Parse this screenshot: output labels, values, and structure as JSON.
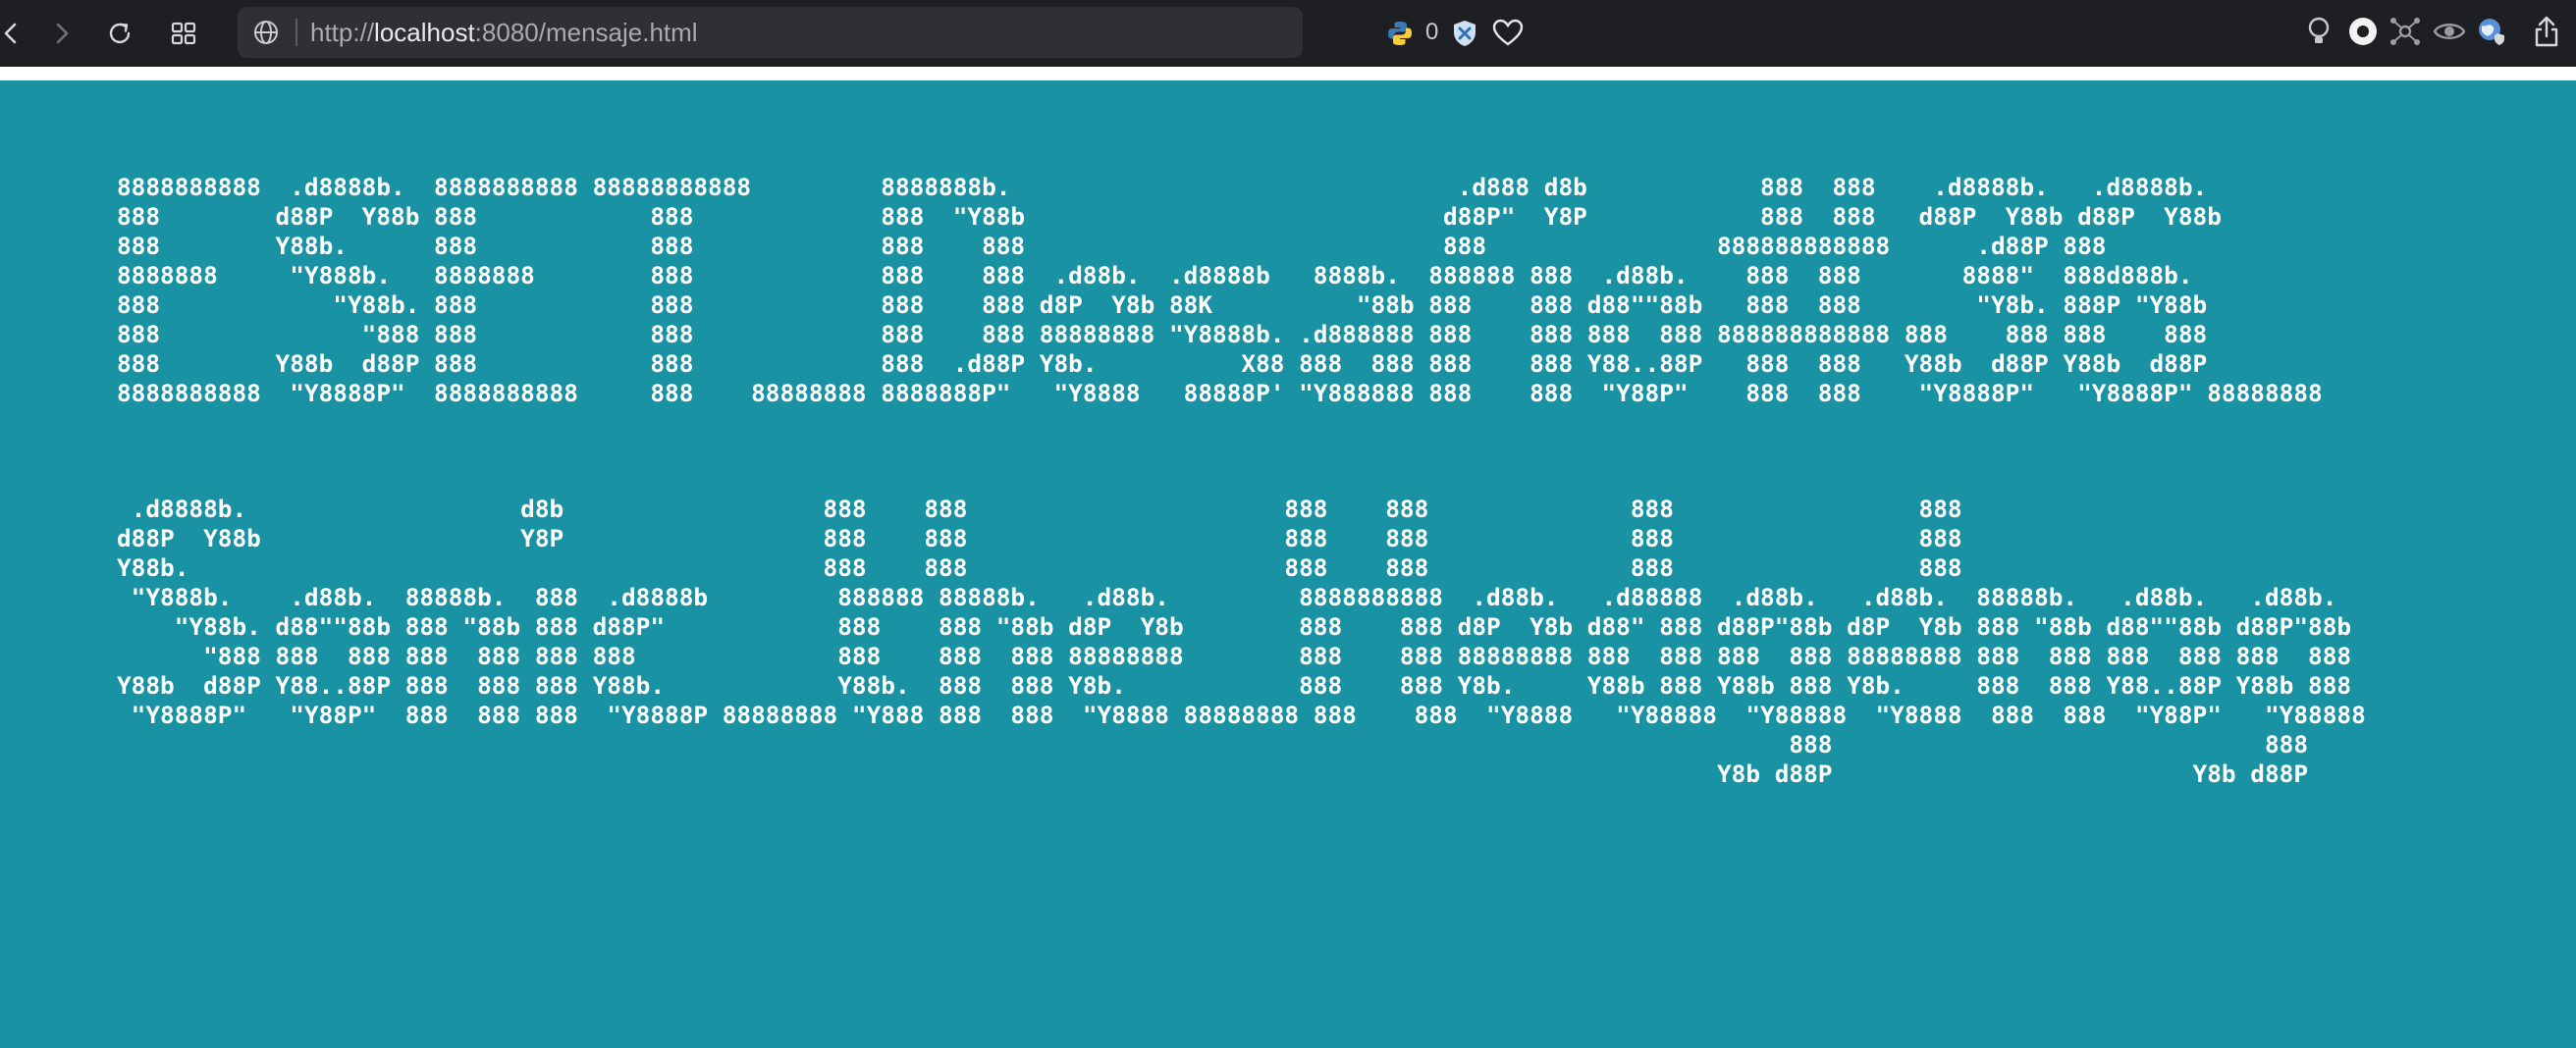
{
  "browser": {
    "url_prefix": "http://",
    "url_host": "localhost",
    "url_rest": ":8080/mensaje.html",
    "extension_count": "0"
  },
  "message": {
    "block_1": "8888888888  .d8888b.  8888888888 88888888888         8888888b.                               .d888 d8b            888  888    .d8888b.   .d8888b.\n888        d88P  Y88b 888            888             888  \"Y88b                             d88P\"  Y8P            888  888   d88P  Y88b d88P  Y88b\n888        Y88b.      888            888             888    888                             888                888888888888      .d88P 888\n8888888     \"Y888b.   8888888        888             888    888  .d88b.  .d8888b   8888b.  888888 888  .d88b.    888  888       8888\"  888d888b.\n888            \"Y88b. 888            888             888    888 d8P  Y8b 88K          \"88b 888    888 d88\"\"88b   888  888        \"Y8b. 888P \"Y88b\n888              \"888 888            888             888    888 88888888 \"Y8888b. .d888888 888    888 888  888 888888888888 888    888 888    888\n888        Y88b  d88P 888            888             888  .d88P Y8b.          X88 888  888 888    888 Y88..88P   888  888   Y88b  d88P Y88b  d88P\n8888888888  \"Y8888P\"  8888888888     888    88888888 8888888P\"   \"Y8888   88888P' \"Y888888 888    888  \"Y88P\"    888  888    \"Y8888P\"   \"Y8888P\" 88888888",
    "block_2": " .d8888b.                   d8b                  888    888                      888    888              888                 888\nd88P  Y88b                  Y8P                  888    888                      888    888              888                 888\nY88b.                                            888    888                      888    888              888                 888\n \"Y888b.    .d88b.  88888b.  888  .d8888b         888888 88888b.   .d88b.         8888888888  .d88b.   .d88888  .d88b.   .d88b.  88888b.   .d88b.   .d88b.\n    \"Y88b. d88\"\"88b 888 \"88b 888 d88P\"            888    888 \"88b d8P  Y8b        888    888 d8P  Y8b d88\" 888 d88P\"88b d8P  Y8b 888 \"88b d88\"\"88b d88P\"88b\n      \"888 888  888 888  888 888 888              888    888  888 88888888        888    888 88888888 888  888 888  888 88888888 888  888 888  888 888  888\nY88b  d88P Y88..88P 888  888 888 Y88b.            Y88b.  888  888 Y8b.            888    888 Y8b.     Y88b 888 Y88b 888 Y8b.     888  888 Y88..88P Y88b 888\n \"Y8888P\"   \"Y88P\"  888  888 888  \"Y8888P 88888888 \"Y888 888  888  \"Y8888 88888888 888    888  \"Y8888   \"Y88888  \"Y88888  \"Y8888  888  888  \"Y88P\"   \"Y88888\n                                                                                                                    888                              888\n                                                                                                               Y8b d88P                         Y8b d88P"
  },
  "colors": {
    "page_background": "#1993a4",
    "toolbar_background": "#1e1f22",
    "text": "#ffffff"
  },
  "icons": {
    "back": "chevron-left-icon",
    "forward": "chevron-right-icon",
    "reload": "reload-icon",
    "tabs": "tab-grid-icon",
    "site": "globe-icon",
    "python_ext": "python-icon",
    "shield_ext": "shield-icon",
    "favorite": "heart-icon",
    "share": "share-icon"
  }
}
